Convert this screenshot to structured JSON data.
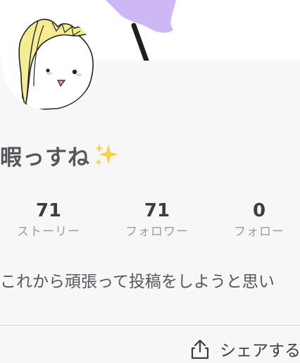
{
  "profile": {
    "username": "暇っすね",
    "username_emoji_icon": "sparkles-icon",
    "bio": "これから頑張って投稿をしようと思い"
  },
  "stats": [
    {
      "value": "71",
      "label": "ストーリー"
    },
    {
      "value": "71",
      "label": "フォロワー"
    },
    {
      "value": "0",
      "label": "フォロー"
    }
  ],
  "actions": {
    "share_label": "シェアする",
    "share_icon": "share-icon"
  },
  "colors": {
    "background": "#f7f7f8",
    "text_primary": "#3a3d42",
    "text_secondary": "#9a9ca1",
    "sparkle": "#f2d24a",
    "cover_accent": "#cdb8f5"
  }
}
